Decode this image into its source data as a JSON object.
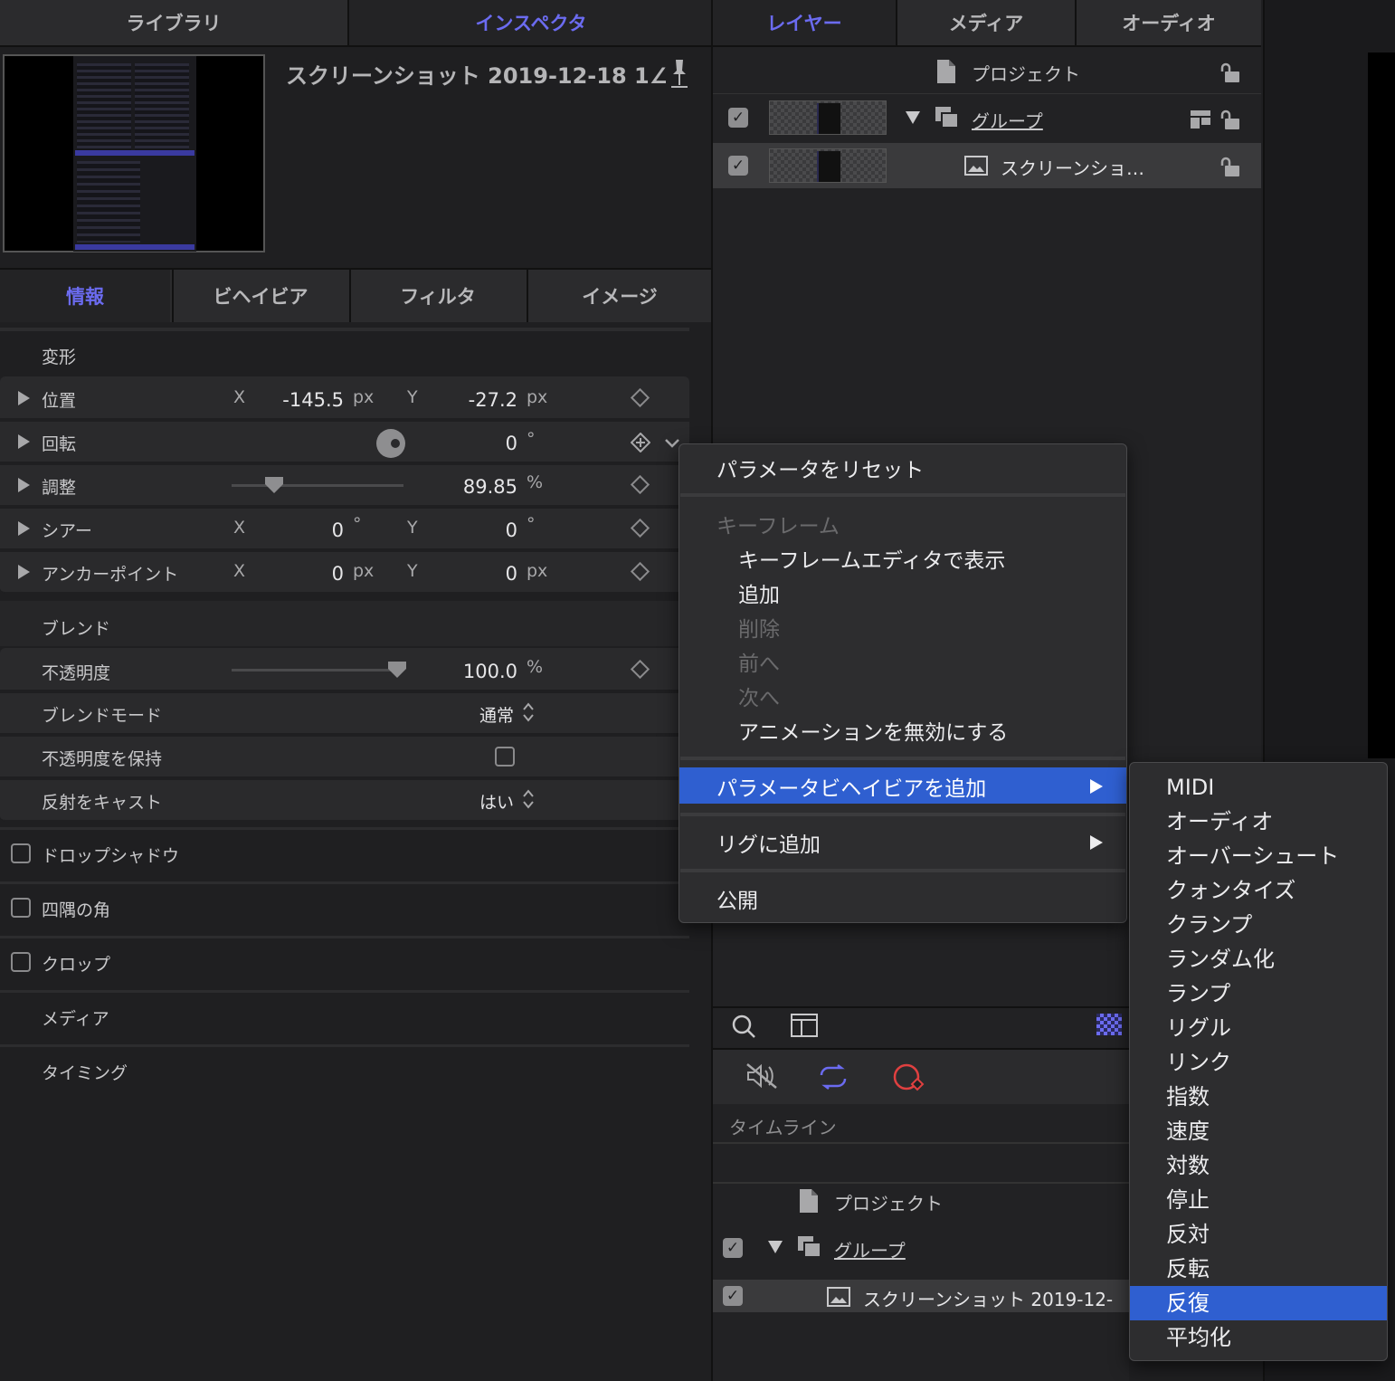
{
  "top_tabs": {
    "library": "ライブラリ",
    "inspector": "インスペクタ"
  },
  "layer_tabs": {
    "layers": "レイヤー",
    "media": "メディア",
    "audio": "オーディオ"
  },
  "inspector": {
    "title": "スクリーンショット 2019-12-18 1∠",
    "subtabs": {
      "info": "情報",
      "behavior": "ビヘイビア",
      "filter": "フィルタ",
      "image": "イメージ"
    },
    "transform": {
      "header": "変形",
      "position": {
        "label": "位置",
        "x_axis": "X",
        "x_value": "-145.5",
        "x_unit": "px",
        "y_axis": "Y",
        "y_value": "-27.2",
        "y_unit": "px"
      },
      "rotation": {
        "label": "回転",
        "value": "0",
        "unit": "°"
      },
      "scale": {
        "label": "調整",
        "value": "89.85",
        "unit": "%"
      },
      "shear": {
        "label": "シアー",
        "x_axis": "X",
        "x_value": "0",
        "x_unit": "°",
        "y_axis": "Y",
        "y_value": "0",
        "y_unit": "°"
      },
      "anchor": {
        "label": "アンカーポイント",
        "x_axis": "X",
        "x_value": "0",
        "x_unit": "px",
        "y_axis": "Y",
        "y_value": "0",
        "y_unit": "px"
      }
    },
    "blend": {
      "header": "ブレンド",
      "opacity": {
        "label": "不透明度",
        "value": "100.0",
        "unit": "%"
      },
      "blend_mode": {
        "label": "ブレンドモード",
        "value": "通常"
      },
      "preserve_opacity": {
        "label": "不透明度を保持"
      },
      "cast_reflection": {
        "label": "反射をキャスト",
        "value": "はい"
      }
    },
    "sections": {
      "drop_shadow": "ドロップシャドウ",
      "four_corner": "四隅の角",
      "crop": "クロップ",
      "media": "メディア",
      "timing": "タイミング"
    }
  },
  "layers": {
    "project": "プロジェクト",
    "group": "グループ",
    "screenshot": "スクリーンショ…"
  },
  "timeline": {
    "label": "タイムライン",
    "project": "プロジェクト",
    "group": "グループ",
    "screenshot": "スクリーンショット 2019-12-"
  },
  "context_menu": {
    "reset": "パラメータをリセット",
    "keyframe_header": "キーフレーム",
    "show_in_editor": "キーフレームエディタで表示",
    "add": "追加",
    "delete": "削除",
    "previous": "前へ",
    "next": "次へ",
    "disable_animation": "アニメーションを無効にする",
    "add_param_behavior": "パラメータビヘイビアを追加",
    "add_to_rig": "リグに追加",
    "publish": "公開"
  },
  "submenu": {
    "items": [
      "MIDI",
      "オーディオ",
      "オーバーシュート",
      "クォンタイズ",
      "クランプ",
      "ランダム化",
      "ランプ",
      "リグル",
      "リンク",
      "指数",
      "速度",
      "対数",
      "停止",
      "反対",
      "反転",
      "反復",
      "平均化"
    ],
    "highlighted": "反復"
  },
  "colors": {
    "accent": "#6b6bf0",
    "highlight": "#2f5fd0",
    "panel": "#2a2a2c",
    "background": "#1f1f21"
  }
}
